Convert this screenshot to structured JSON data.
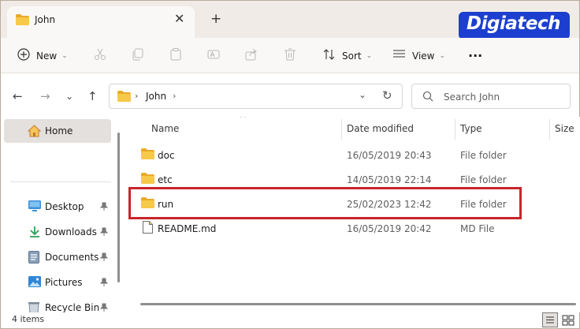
{
  "tab": {
    "title": "John",
    "close": "✕",
    "new_tab": "+"
  },
  "brand": {
    "logo_text": "Digiatech",
    "color": "#1c3fcf"
  },
  "toolbar": {
    "new_label": "New",
    "sort_label": "Sort",
    "view_label": "View",
    "more": "···",
    "chevron": "⌄",
    "icons": [
      "plus-circle-icon",
      "cut-icon",
      "copy-icon",
      "paste-icon",
      "rename-icon",
      "share-icon",
      "delete-icon",
      "sort-icon",
      "view-icon",
      "more-icon"
    ]
  },
  "nav": {
    "back": "←",
    "forward": "→",
    "recent": "⌄",
    "up": "↑"
  },
  "address": {
    "separator": "›",
    "path": "John",
    "dropdown": "⌄",
    "refresh": "↻"
  },
  "search": {
    "placeholder": "Search John"
  },
  "sidebar": {
    "home": "Home",
    "items": [
      {
        "label": "Desktop",
        "icon": "desktop-icon",
        "pinned": true
      },
      {
        "label": "Downloads",
        "icon": "download-icon",
        "pinned": true
      },
      {
        "label": "Documents",
        "icon": "documents-icon",
        "pinned": true
      },
      {
        "label": "Pictures",
        "icon": "pictures-icon",
        "pinned": true
      },
      {
        "label": "Recycle Bin",
        "icon": "recycle-bin-icon",
        "pinned": true
      }
    ]
  },
  "columns": {
    "name": "Name",
    "date": "Date modified",
    "type": "Type",
    "size": "Size",
    "sort_indicator": "^"
  },
  "files": [
    {
      "name": "doc",
      "date": "16/05/2019 20:43",
      "type": "File folder",
      "icon": "folder-icon"
    },
    {
      "name": "etc",
      "date": "14/05/2019 22:14",
      "type": "File folder",
      "icon": "folder-icon"
    },
    {
      "name": "run",
      "date": "25/02/2023 12:42",
      "type": "File folder",
      "icon": "folder-icon",
      "highlighted": true
    },
    {
      "name": "README.md",
      "date": "16/05/2019 20:42",
      "type": "MD File",
      "icon": "file-icon"
    }
  ],
  "status": {
    "count": "4 items"
  },
  "colors": {
    "folder": "#f2c14e",
    "highlight": "#c8252c",
    "accent": "#0a5fc6"
  }
}
